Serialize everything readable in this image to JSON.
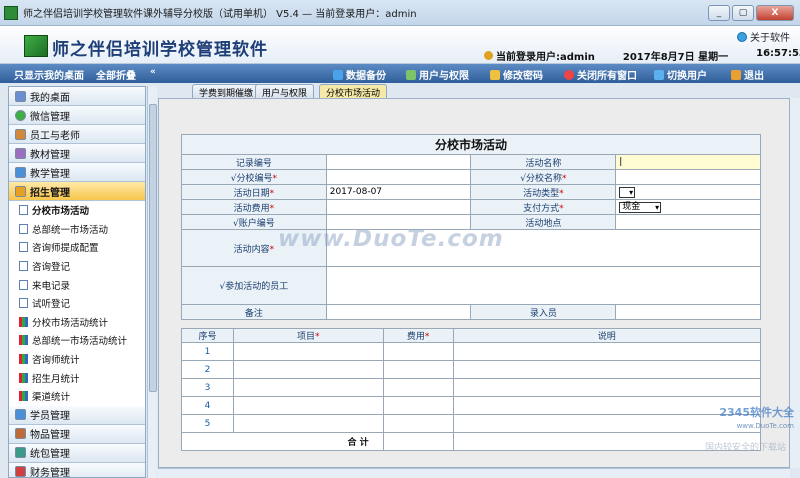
{
  "window": {
    "title": "师之伴侣培训学校管理软件课外辅导分校版（试用单机） V5.4 — 当前登录用户：admin",
    "buttons": [
      "_",
      "▢",
      "X"
    ]
  },
  "header": {
    "app_title": "师之伴侣培训学校管理软件",
    "about": "关于软件",
    "current_user": "当前登录用户:admin",
    "date": "2017年8月7日",
    "weekday": "星期一",
    "time": "16:57:53"
  },
  "toolbar": {
    "left": [
      "只显示我的桌面",
      "全部折叠"
    ],
    "right": [
      {
        "label": "数据备份",
        "icon": "database-icon",
        "color": "#4aa3e8"
      },
      {
        "label": "用户与权限",
        "icon": "users-icon",
        "color": "#7cc36a"
      },
      {
        "label": "修改密码",
        "icon": "key-icon",
        "color": "#f0c040"
      },
      {
        "label": "关闭所有窗口",
        "icon": "close-all-icon",
        "color": "#e44"
      },
      {
        "label": "切换用户",
        "icon": "switch-user-icon",
        "color": "#5bb0f0"
      },
      {
        "label": "退出",
        "icon": "exit-icon",
        "color": "#e9a030"
      }
    ]
  },
  "sidebar": {
    "sections_top": [
      {
        "label": "我的桌面",
        "color": "#6a8fd0"
      },
      {
        "label": "微信管理",
        "color": "#3cb043"
      },
      {
        "label": "员工与老师",
        "color": "#d08a3a"
      },
      {
        "label": "教材管理",
        "color": "#9a6fc0"
      },
      {
        "label": "教学管理",
        "color": "#4a90d9"
      },
      {
        "label": "招生管理",
        "color": "#e8a020"
      }
    ],
    "items": [
      {
        "label": "分校市场活动",
        "type": "doc"
      },
      {
        "label": "总部统一市场活动",
        "type": "doc"
      },
      {
        "label": "咨询师提成配置",
        "type": "doc"
      },
      {
        "label": "咨询登记",
        "type": "doc"
      },
      {
        "label": "来电记录",
        "type": "doc"
      },
      {
        "label": "试听登记",
        "type": "doc"
      },
      {
        "label": "分校市场活动统计",
        "type": "bar"
      },
      {
        "label": "总部统一市场活动统计",
        "type": "bar"
      },
      {
        "label": "咨询师统计",
        "type": "bar"
      },
      {
        "label": "招生月统计",
        "type": "bar"
      },
      {
        "label": "渠道统计",
        "type": "bar"
      }
    ],
    "sections_bottom": [
      {
        "label": "学员管理",
        "color": "#4a90d9"
      },
      {
        "label": "物品管理",
        "color": "#c06a3a"
      },
      {
        "label": "统包管理",
        "color": "#3a9a8a"
      },
      {
        "label": "财务管理",
        "color": "#d04040"
      }
    ]
  },
  "tabs": [
    {
      "label": "学费到期催缴"
    },
    {
      "label": "用户与权限"
    },
    {
      "label": "分校市场活动"
    }
  ],
  "form": {
    "title": "分校市场活动",
    "record_no": "记录编号",
    "activity_name": "活动名称",
    "branch_no": "√分校编号",
    "branch_name": "√分校名称",
    "activity_date": "活动日期",
    "activity_date_value": "2017-08-07",
    "activity_type": "活动类型",
    "activity_fee": "活动费用",
    "payment_method": "支付方式",
    "payment_method_value": "现金",
    "account_no": "√账户编号",
    "activity_location": "活动地点",
    "activity_content": "活动内容",
    "participants": "√参加活动的员工",
    "remark": "备注",
    "entered_by": "录入员",
    "star": "*"
  },
  "detail": {
    "headers": [
      "序号",
      "项目",
      "费用",
      "说明"
    ],
    "rows": [
      "1",
      "2",
      "3",
      "4",
      "5"
    ],
    "total": "合 计"
  },
  "watermark": {
    "main": "www.DuoTe.com",
    "brand": "2345软件大全",
    "url": "www.DuoTe.com",
    "slogan": "国内较安全的下载站"
  }
}
